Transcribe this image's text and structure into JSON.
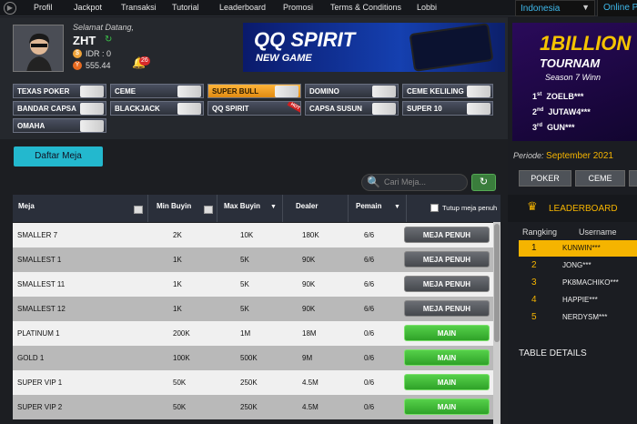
{
  "nav": {
    "items": [
      "Profil",
      "Jackpot",
      "Transaksi",
      "Tutorial",
      "Leaderboard",
      "Promosi",
      "Terms & Conditions",
      "Lobbi"
    ],
    "language": "Indonesia",
    "online_partial": "Online P"
  },
  "user": {
    "welcome": "Selamat Datang,",
    "name": "ZHT",
    "idr": "IDR : 0",
    "points": "555.44",
    "notif_count": "26"
  },
  "banner": {
    "title": "QQ SPIRIT",
    "subtitle": "NEW GAME"
  },
  "games": [
    {
      "label": "TEXAS POKER"
    },
    {
      "label": "CEME"
    },
    {
      "label": "SUPER BULL"
    },
    {
      "label": "DOMINO"
    },
    {
      "label": "CEME KELILING"
    },
    {
      "label": "BANDAR CAPSA"
    },
    {
      "label": "BLACKJACK"
    },
    {
      "label": "QQ SPIRIT"
    },
    {
      "label": "CAPSA SUSUN"
    },
    {
      "label": "SUPER 10"
    },
    {
      "label": "OMAHA"
    }
  ],
  "table": {
    "daftar_label": "Daftar Meja",
    "search_placeholder": "Cari Meja...",
    "headers": {
      "meja": "Meja",
      "min": "Min Buyin",
      "max": "Max Buyin",
      "dealer": "Dealer",
      "pemain": "Pemain",
      "tutup": "Tutup meja penuh"
    },
    "rows": [
      {
        "meja": "SMALLER 7",
        "min": "2K",
        "max": "10K",
        "dealer": "180K",
        "pemain": "6/6",
        "action": "MEJA PENUH"
      },
      {
        "meja": "SMALLEST 1",
        "min": "1K",
        "max": "5K",
        "dealer": "90K",
        "pemain": "6/6",
        "action": "MEJA PENUH"
      },
      {
        "meja": "SMALLEST 11",
        "min": "1K",
        "max": "5K",
        "dealer": "90K",
        "pemain": "6/6",
        "action": "MEJA PENUH"
      },
      {
        "meja": "SMALLEST 12",
        "min": "1K",
        "max": "5K",
        "dealer": "90K",
        "pemain": "6/6",
        "action": "MEJA PENUH"
      },
      {
        "meja": "PLATINUM 1",
        "min": "200K",
        "max": "1M",
        "dealer": "18M",
        "pemain": "0/6",
        "action": "MAIN"
      },
      {
        "meja": "GOLD 1",
        "min": "100K",
        "max": "500K",
        "dealer": "9M",
        "pemain": "0/6",
        "action": "MAIN"
      },
      {
        "meja": "SUPER VIP 1",
        "min": "50K",
        "max": "250K",
        "dealer": "4.5M",
        "pemain": "0/6",
        "action": "MAIN"
      },
      {
        "meja": "SUPER VIP 2",
        "min": "50K",
        "max": "250K",
        "dealer": "4.5M",
        "pemain": "0/6",
        "action": "MAIN"
      }
    ]
  },
  "tournament": {
    "title": "1BILLION",
    "subtitle": "TOURNAM",
    "season": "Season 7 Winn",
    "winners": [
      {
        "rank": "1",
        "suffix": "st",
        "name": "ZOELB***"
      },
      {
        "rank": "2",
        "suffix": "nd",
        "name": "JUTAW4***"
      },
      {
        "rank": "3",
        "suffix": "rd",
        "name": "GUN***"
      }
    ]
  },
  "periode": {
    "label": "Periode:",
    "value": "September 2021"
  },
  "tabs": [
    "POKER",
    "CEME"
  ],
  "leaderboard": {
    "title": "LEADERBOARD",
    "col_rank": "Rangking",
    "col_user": "Username",
    "rows": [
      {
        "rank": "1",
        "name": "KUNWIN***"
      },
      {
        "rank": "2",
        "name": "JONG***"
      },
      {
        "rank": "3",
        "name": "PK8MACHIKO***"
      },
      {
        "rank": "4",
        "name": "HAPPIE***"
      },
      {
        "rank": "5",
        "name": "NERDYSM***"
      }
    ]
  },
  "table_details": "TABLE DETAILS",
  "colors": {
    "accent": "#23b8ce",
    "gold": "#f5b400",
    "green": "#3cc44a",
    "full": "#555"
  }
}
